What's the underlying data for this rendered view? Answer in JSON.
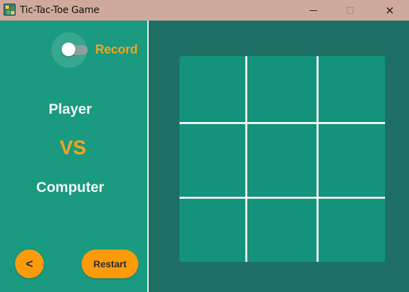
{
  "window": {
    "title": "Tic-Tac-Toe Game",
    "close_glyph": "✕"
  },
  "sidebar": {
    "record_label": "Record",
    "record_enabled": false,
    "player_label": "Player",
    "vs_label": "VS",
    "computer_label": "Computer",
    "back_label": "<",
    "restart_label": "Restart"
  },
  "board": {
    "rows": 3,
    "cols": 3,
    "cells": [
      "",
      "",
      "",
      "",
      "",
      "",
      "",
      "",
      ""
    ]
  },
  "colors": {
    "titlebar": "#cfa99c",
    "sidebar": "#1a9a80",
    "background": "#1e7065",
    "board": "#13937b",
    "accent": "#f4a51b",
    "button": "#fb9b0c",
    "grid_line": "#eef4f2"
  }
}
